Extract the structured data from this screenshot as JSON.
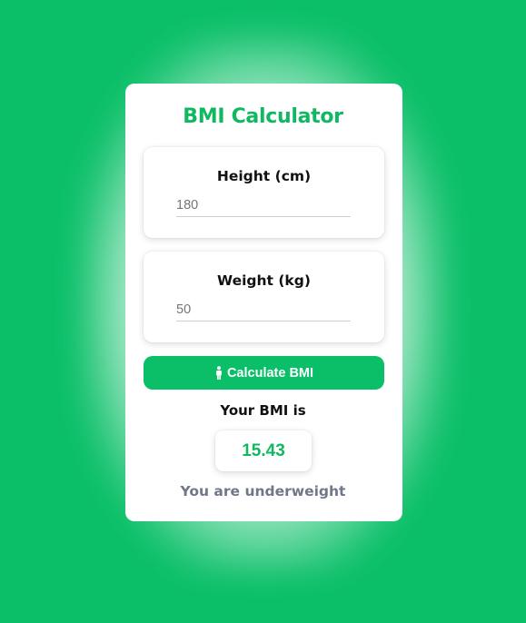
{
  "app": {
    "title": "BMI Calculator"
  },
  "height": {
    "label": "Height (cm)",
    "placeholder": "180"
  },
  "weight": {
    "label": "Weight (kg)",
    "placeholder": "50"
  },
  "actions": {
    "calculate_label": "Calculate BMI",
    "calculate_icon": "person-icon"
  },
  "result": {
    "label": "Your BMI is",
    "value": "15.43",
    "status": "You are underweight"
  },
  "colors": {
    "background": "#0abf67",
    "accent": "#11b862",
    "status_text": "#6f7789"
  }
}
